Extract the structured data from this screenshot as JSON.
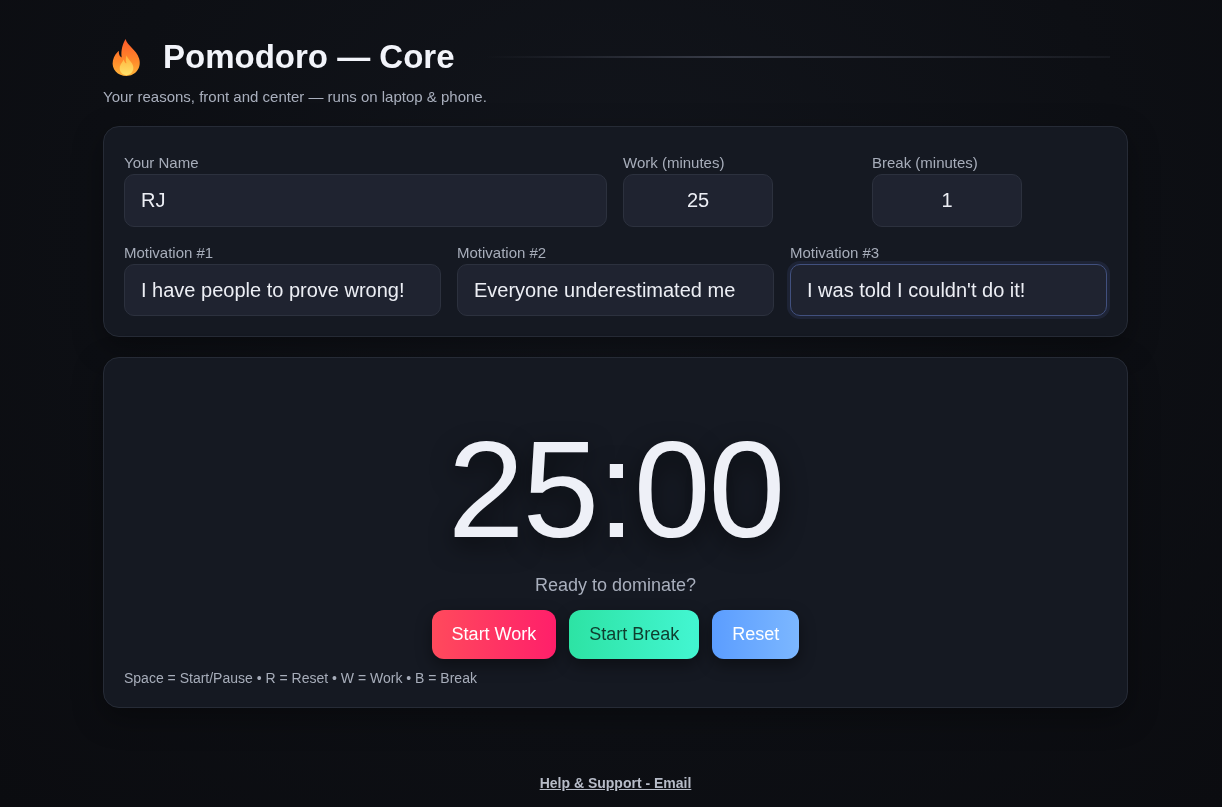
{
  "header": {
    "title": "Pomodoro — Core",
    "subtitle": "Your reasons, front and center — runs on laptop & phone."
  },
  "settings": {
    "fields": [
      {
        "label": "Your Name",
        "value": "RJ",
        "kind": "text",
        "focused": false
      },
      {
        "label": "Work (minutes)",
        "value": "25",
        "kind": "number",
        "focused": false
      },
      {
        "label": "Break (minutes)",
        "value": "1",
        "kind": "number",
        "focused": false
      }
    ],
    "motivations": [
      {
        "label": "Motivation #1",
        "value": "I have people to prove wrong!",
        "focused": false
      },
      {
        "label": "Motivation #2",
        "value": "Everyone underestimated me",
        "focused": false
      },
      {
        "label": "Motivation #3",
        "value": "I was told I couldn't do it!",
        "focused": true
      }
    ]
  },
  "timer": {
    "display": "25:00",
    "status": "Ready to dominate?",
    "buttons": [
      {
        "label": "Start Work",
        "kind": "work"
      },
      {
        "label": "Start Break",
        "kind": "break"
      },
      {
        "label": "Reset",
        "kind": "reset"
      }
    ],
    "shortcuts": "Space = Start/Pause • R = Reset • W = Work • B = Break"
  },
  "footer": {
    "link": "Help & Support - Email"
  }
}
